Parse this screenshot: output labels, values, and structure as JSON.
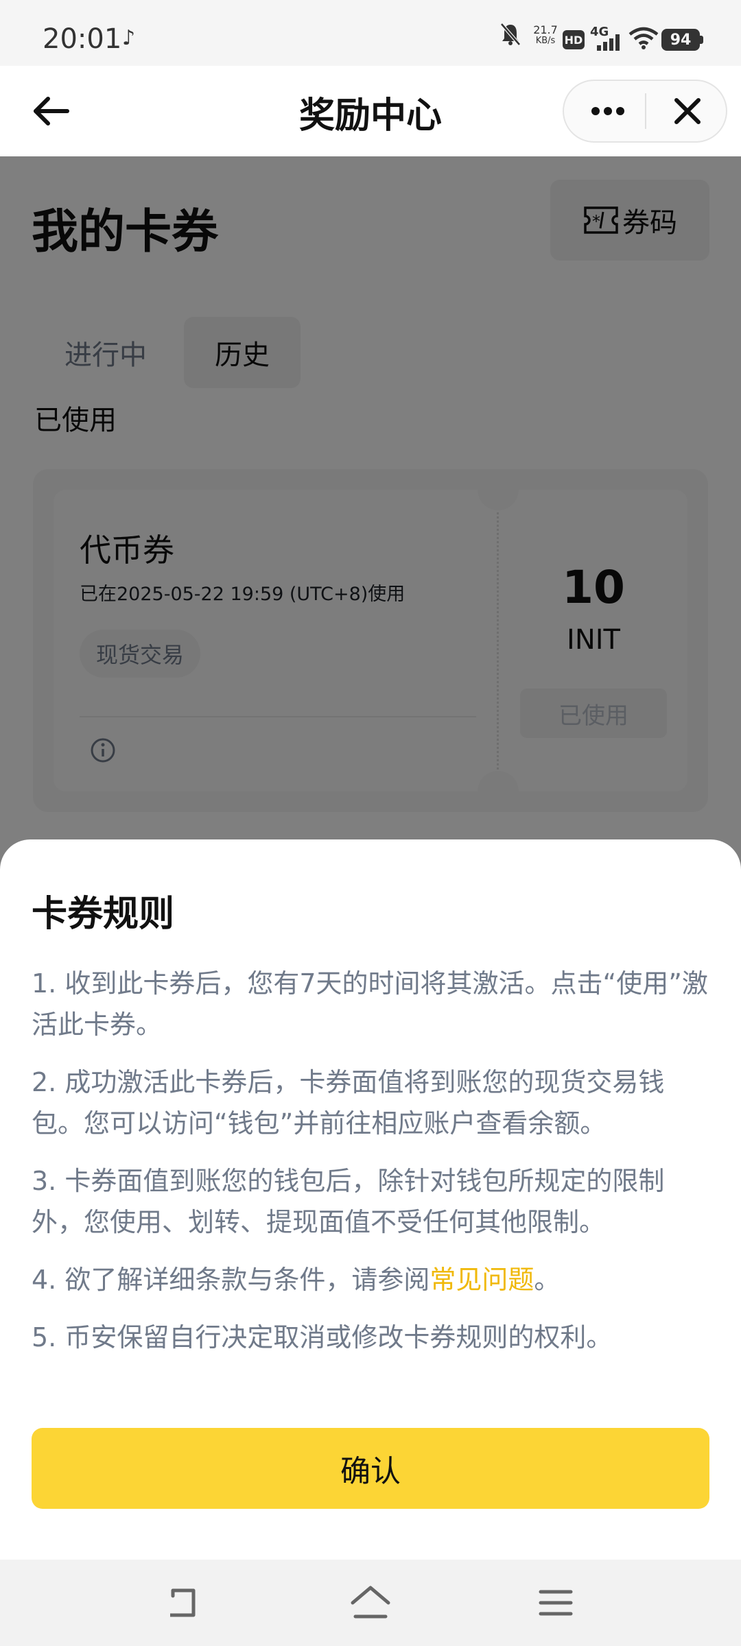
{
  "status_bar": {
    "time": "20:01",
    "note_icon": "music-note-icon",
    "net_speed_value": "21.7",
    "net_speed_unit": "KB/s",
    "hd_label": "HD",
    "network_label": "4G",
    "battery": "94"
  },
  "header": {
    "title": "奖励中心",
    "back_icon": "arrow-left-icon",
    "more_icon": "more-dots-icon",
    "close_icon": "close-icon"
  },
  "page": {
    "title": "我的卡券",
    "code_button_label": "券码",
    "tabs": [
      {
        "label": "进行中",
        "active": false
      },
      {
        "label": "历史",
        "active": true
      }
    ],
    "section_label": "已使用",
    "card": {
      "title": "代币券",
      "subtitle": "已在2025-05-22 19:59 (UTC+8)使用",
      "tag": "现货交易",
      "amount": "10",
      "unit": "INIT",
      "status_button": "已使用"
    }
  },
  "sheet": {
    "title": "卡券规则",
    "rules": [
      "1. 收到此卡券后，您有7天的时间将其激活。点击“使用”激活此卡券。",
      "2. 成功激活此卡券后，卡券面值将到账您的现货交易钱包。您可以访问“钱包”并前往相应账户查看余额。",
      "3. 卡券面值到账您的钱包后，除针对钱包所规定的限制外，您使用、划转、提现面值不受任何其他限制。"
    ],
    "rule4_prefix": "4. 欲了解详细条款与条件，请参阅",
    "rule4_link": "常见问题",
    "rule4_suffix": "。",
    "rule5": "5. 币安保留自行决定取消或修改卡券规则的权利。",
    "confirm_label": "确认"
  },
  "colors": {
    "accent": "#fcd535",
    "link": "#f0b90b",
    "muted_text": "#707a8a"
  },
  "nav_bar": {
    "back_icon": "nav-back-icon",
    "home_icon": "nav-home-icon",
    "menu_icon": "nav-menu-icon"
  }
}
